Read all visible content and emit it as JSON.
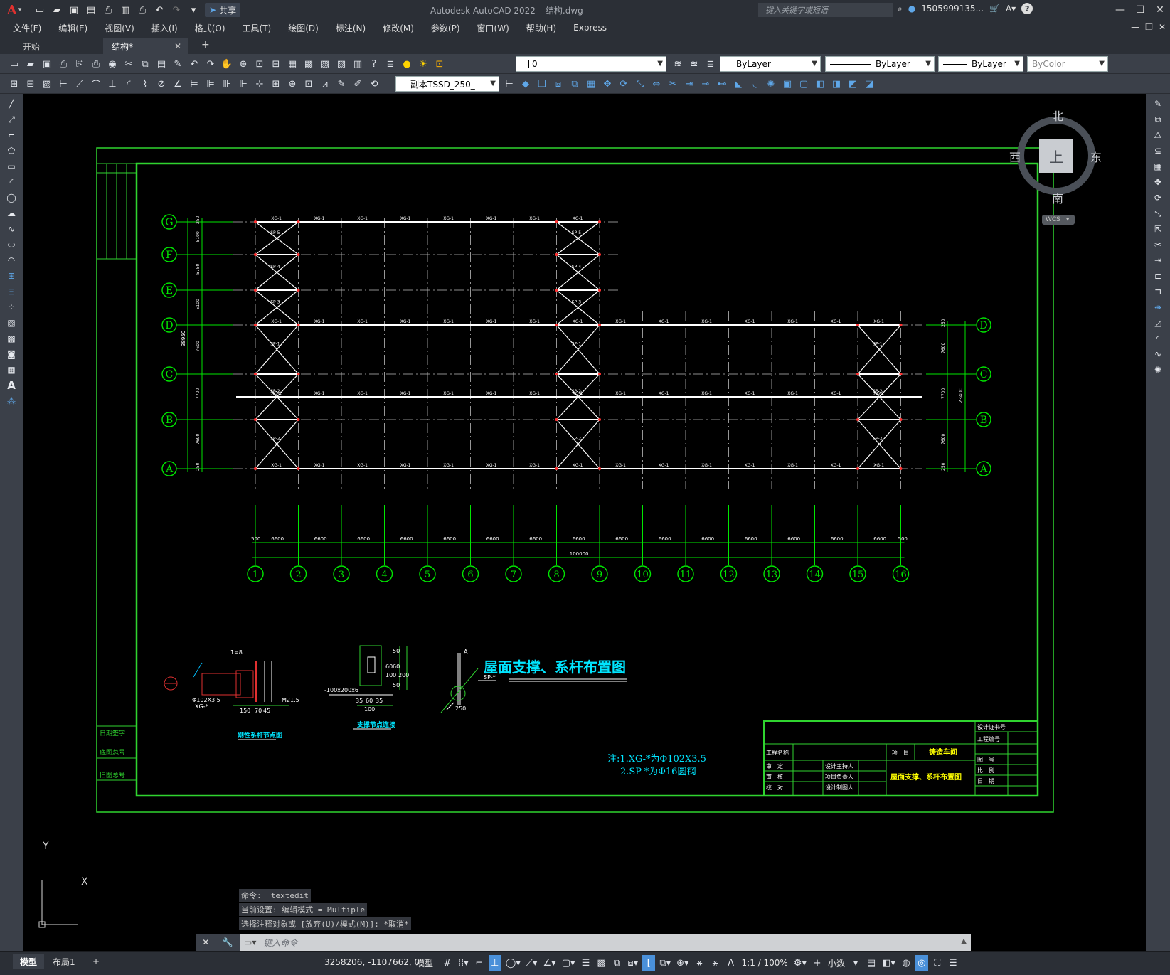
{
  "app": {
    "logo_letter": "A",
    "title": "Autodesk AutoCAD 2022",
    "filename": "结构.dwg",
    "share_label": "共享",
    "search_placeholder": "键入关键字或短语",
    "user": "1505999135...",
    "help": "?"
  },
  "menu": [
    "文件(F)",
    "编辑(E)",
    "视图(V)",
    "插入(I)",
    "格式(O)",
    "工具(T)",
    "绘图(D)",
    "标注(N)",
    "修改(M)",
    "参数(P)",
    "窗口(W)",
    "帮助(H)",
    "Express"
  ],
  "file_tabs": [
    {
      "label": "开始"
    },
    {
      "label": "结构*"
    }
  ],
  "toolbar": {
    "layer_value": "0",
    "color_value": "ByLayer",
    "linetype_value": "ByLayer",
    "lineweight_value": "ByLayer",
    "plotstyle_value": "ByColor",
    "dimstyle_value": "副本TSSD_250_"
  },
  "viewcube": {
    "north": "北",
    "south": "南",
    "east": "东",
    "west": "西",
    "face": "上",
    "wcs": "WCS"
  },
  "drawing": {
    "title": "屋面支撑、系杆布置图",
    "note_1": "注:1.XG-*为Φ102X3.5",
    "note_2": "2.SP-*为Φ16圆钢",
    "row_axes": [
      "G",
      "F",
      "E",
      "D",
      "C",
      "B",
      "A"
    ],
    "col_axes": [
      "1",
      "2",
      "3",
      "4",
      "5",
      "6",
      "7",
      "8",
      "9",
      "10",
      "11",
      "12",
      "13",
      "14",
      "15",
      "16"
    ],
    "col_spacing": [
      "500",
      "6600",
      "6600",
      "6600",
      "6600",
      "6600",
      "6600",
      "6600",
      "6600",
      "6600",
      "6600",
      "6600",
      "6600",
      "6600",
      "6600",
      "6600",
      "500"
    ],
    "total_length": "100000",
    "left_dims": [
      "250",
      "5100",
      "5750",
      "5100",
      "7600",
      "7700",
      "7600",
      "250"
    ],
    "left_total": "38950",
    "right_dims": [
      "250",
      "7600",
      "7700",
      "7600",
      "250"
    ],
    "right_total": "23400",
    "member_xg": "XG-1",
    "member_sp": [
      "SP-5",
      "SP-4",
      "SP-3",
      "SP-1",
      "SP-2",
      "SP-2",
      "SP-1"
    ],
    "detail_1_title": "刚性系杆节点图",
    "detail_2_title": "支撑节点连接",
    "detail_1_labels": [
      "1=8",
      "Φ102X3.5",
      "XG-*",
      "150",
      "70",
      "45",
      "M21.5"
    ],
    "detail_2_labels": [
      "50",
      "60",
      "60",
      "50",
      "100",
      "200",
      "-100x200x6",
      "35",
      "60",
      "35",
      "100"
    ],
    "detail_3_labels": [
      "SP-*",
      "250",
      "A"
    ],
    "title_block": {
      "project_label": "工程名称",
      "item_label": "项　目",
      "item_value": "铸造车间",
      "drawing_name": "屋面支撑、系杆布置图",
      "rows_left": [
        "审　定",
        "审　核",
        "校　对"
      ],
      "rows_mid": [
        "设计主持人",
        "项目负责人",
        "设计制图人"
      ],
      "rows_right": [
        "设计证书号",
        "工程编号",
        "图　号",
        "比　例",
        "日　期"
      ]
    },
    "side_strip": [
      "日期签字",
      "底图总号",
      "旧图总号"
    ]
  },
  "command": {
    "history": [
      "命令: _textedit",
      "当前设置: 编辑模式 = Multiple",
      "选择注释对象或 [放弃(U)/模式(M)]: *取消*"
    ],
    "prompt": "键入命令"
  },
  "ucs": {
    "x": "X",
    "y": "Y"
  },
  "status": {
    "layout_tabs": [
      "模型",
      "布局1"
    ],
    "coords": "3258206, -1107662, 0",
    "model": "模型",
    "scale": "1:1 / 100%",
    "units": "小数"
  },
  "colors": {
    "frame": "#2fd42f",
    "axis": "#00e600",
    "member": "#ffffff",
    "text_cyan": "#00e5ff",
    "text_yellow": "#ffff00"
  }
}
